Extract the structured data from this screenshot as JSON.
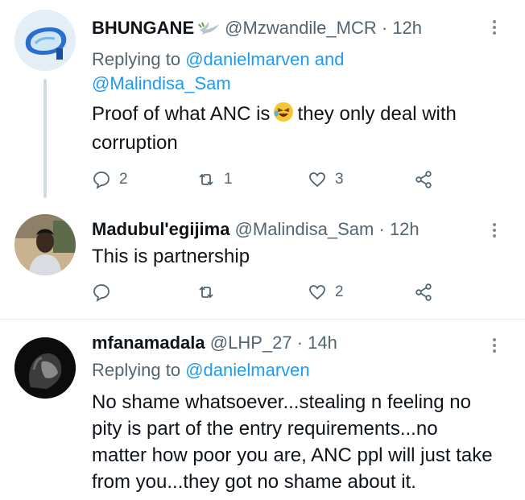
{
  "tweets": [
    {
      "name": "BHUNGANE",
      "badge_icon": "dove-icon",
      "handle": "@Mzwandile_MCR",
      "dot": "·",
      "time": "12h",
      "replying_prefix": "Replying to",
      "replying_to": [
        "@danielmarven",
        "@Malindisa_Sam"
      ],
      "replying_joiner": "and",
      "text_before_emoji": "Proof of what ANC is",
      "emoji_icon": "laughing-face-emoji",
      "text_after_emoji": "they only deal with corruption",
      "replies": "2",
      "retweets": "1",
      "likes": "3"
    },
    {
      "name": "Madubul'egijima",
      "handle": "@Malindisa_Sam",
      "dot": "·",
      "time": "12h",
      "text": "This is partnership",
      "replies": "",
      "retweets": "",
      "likes": "2"
    },
    {
      "name": "mfanamadala",
      "handle": "@LHP_27",
      "dot": "·",
      "time": "14h",
      "replying_prefix": "Replying to",
      "replying_to": [
        "@danielmarven"
      ],
      "text": "No shame whatsoever...stealing n feeling no pity is part of the entry requirements...no matter how poor you are, ANC ppl will just take from you...they got no shame about it."
    }
  ],
  "colors": {
    "accent": "#1d9bf0",
    "secondary_text": "#536471",
    "primary_text": "#0f1419",
    "thread_line": "#cfd9de"
  }
}
